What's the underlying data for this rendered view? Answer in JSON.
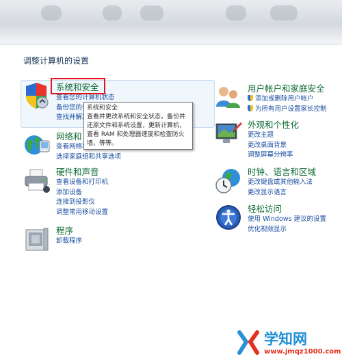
{
  "page_title": "调整计算机的设置",
  "categories": {
    "system": {
      "title": "系统和安全",
      "links": [
        "查看您的计算机状态",
        "备份您的计算机",
        "查找并解决问题"
      ]
    },
    "network": {
      "title": "网络和 Internet",
      "links": [
        "查看网络状态和任务",
        "选择家庭组和共享选项"
      ]
    },
    "hardware": {
      "title": "硬件和声音",
      "links": [
        "查看设备和打印机",
        "添加设备",
        "连接到投影仪",
        "调整常用移动设置"
      ]
    },
    "programs": {
      "title": "程序",
      "links": [
        "卸载程序"
      ]
    },
    "users": {
      "title": "用户帐户和家庭安全",
      "links": [
        "添加或删除用户帐户",
        "为所有用户设置家长控制"
      ]
    },
    "appearance": {
      "title": "外观和个性化",
      "links": [
        "更改主题",
        "更改桌面背景",
        "调整屏幕分辨率"
      ]
    },
    "clock": {
      "title": "时钟、语言和区域",
      "links": [
        "更改键盘或其他输入法",
        "更改显示语言"
      ]
    },
    "access": {
      "title": "轻松访问",
      "links": [
        "使用 Windows 建议的设置",
        "优化视频显示"
      ]
    }
  },
  "tooltip": {
    "lines": [
      "系统和安全",
      "查看并更改系统和安全状态，备份并",
      "还原文件和系统设置，更新计算机，",
      "查看 RAM 和处理器速度和检查防火",
      "墙，等等。"
    ]
  },
  "watermark": {
    "title": "学知网",
    "url": "www.jmqz1000.com"
  },
  "colors": {
    "title_green": "#0e6a32",
    "link_blue": "#1a4fa0",
    "highlight_red": "#e0161c"
  }
}
